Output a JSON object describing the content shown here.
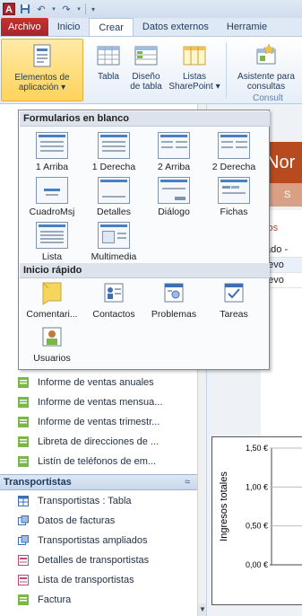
{
  "app": {
    "icon_letter": "A"
  },
  "tabs": [
    "Archivo",
    "Inicio",
    "Crear",
    "Datos externos",
    "Herramie"
  ],
  "ribbon": {
    "buttons": [
      {
        "label": "Elementos de aplicación ▾"
      },
      {
        "label": "Tabla"
      },
      {
        "label": "Diseño de tabla"
      },
      {
        "label": "Listas SharePoint ▾"
      },
      {
        "label": "Asistente para consultas"
      }
    ],
    "group_label": "Consult"
  },
  "dropdown": {
    "section1": "Formularios en blanco",
    "section2": "Inicio rápido",
    "blank_items": [
      "1 Arriba",
      "1 Derecha",
      "2 Arriba",
      "2 Derecha",
      "CuadroMsj",
      "Detalles",
      "Diálogo",
      "Fichas",
      "Lista",
      "Multimedia"
    ],
    "quick_items": [
      "Comentari...",
      "Contactos",
      "Problemas",
      "Tareas",
      "Usuarios"
    ]
  },
  "document": {
    "title": "Nor",
    "sub": "S",
    "link": "vos",
    "rows": [
      "tado -",
      "uevo",
      "uevo"
    ]
  },
  "chart_data": {
    "type": "bar",
    "ylabel": "Ingresos totales",
    "y_ticks": [
      "1,50 €",
      "1,00 €",
      "0,50 €",
      "0,00 €"
    ],
    "ylim": [
      0,
      1.5
    ],
    "values": []
  },
  "nav": {
    "items_top": [
      "Informe de ventas anuales",
      "Informe de ventas mensua...",
      "Informe de ventas trimestr...",
      "Libreta de direcciones de ...",
      "Listín de teléfonos de em..."
    ],
    "group": "Transportistas",
    "group_items": [
      {
        "label": "Transportistas : Tabla",
        "icon": "table-icon"
      },
      {
        "label": "Datos de facturas",
        "icon": "query-icon"
      },
      {
        "label": "Transportistas ampliados",
        "icon": "query-icon"
      },
      {
        "label": "Detalles de transportistas",
        "icon": "form-icon"
      },
      {
        "label": "Lista de transportistas",
        "icon": "form-icon"
      },
      {
        "label": "Factura",
        "icon": "report-icon"
      }
    ]
  }
}
